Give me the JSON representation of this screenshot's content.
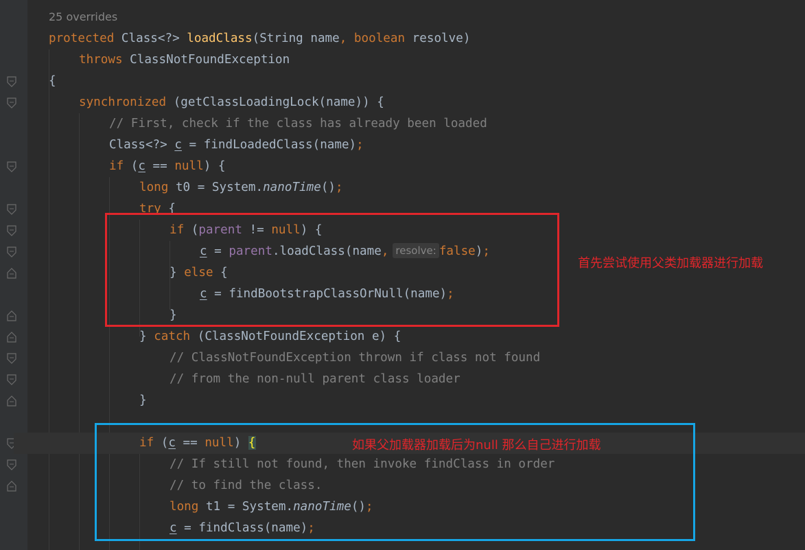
{
  "editor": {
    "override_hint": "25 overrides",
    "colors": {
      "background": "#2b2b2b",
      "keyword": "#cc7832",
      "method": "#ffc66d",
      "comment": "#808080",
      "field": "#9876aa",
      "text": "#a9b7c6",
      "annotation_red": "#e0262b",
      "annotation_blue": "#16a5e4"
    },
    "lines": {
      "l1": {
        "kw1": "protected",
        "t1": " Class<?> ",
        "fn": "loadClass",
        "t2": "(String name",
        "kw2": ",",
        "kw3": " boolean",
        "t3": " resolve)"
      },
      "l2": {
        "kw": "throws",
        "t": " ClassNotFoundException"
      },
      "l3": {
        "t": "{"
      },
      "l4": {
        "kw": "synchronized",
        "t": " (getClassLoadingLock(name)) {"
      },
      "l5": {
        "cm": "// First, check if the class has already been loaded"
      },
      "l6": {
        "t1": "Class<?> ",
        "var": "c",
        "t2": " = findLoadedClass(name)",
        "semi": ";"
      },
      "l7": {
        "kw": "if",
        "t1": " (",
        "var": "c",
        "t2": " == ",
        "kw2": "null",
        "t3": ") {"
      },
      "l8": {
        "kw": "long",
        "t1": " t0 = System.",
        "it": "nanoTime",
        "t2": "()",
        "semi": ";"
      },
      "l9": {
        "kw": "try",
        "t": " {"
      },
      "l10": {
        "kw": "if",
        "t1": " (",
        "fld": "parent",
        "t2": " != ",
        "kw2": "null",
        "t3": ") {"
      },
      "l11": {
        "var": "c",
        "t1": " = ",
        "fld": "parent",
        "t2": ".loadClass(name",
        "comma": ",",
        "hint": "resolve:",
        "kw": "false",
        "t3": ")",
        "semi": ";"
      },
      "l12": {
        "t1": "} ",
        "kw": "else",
        "t2": " {"
      },
      "l13": {
        "var": "c",
        "t1": " = findBootstrapClassOrNull(name)",
        "semi": ";"
      },
      "l14": {
        "t": "}"
      },
      "l15": {
        "t1": "} ",
        "kw": "catch",
        "t2": " (ClassNotFoundException e) {"
      },
      "l16": {
        "cm": "// ClassNotFoundException thrown if class not found"
      },
      "l17": {
        "cm": "// from the non-null parent class loader"
      },
      "l18": {
        "t": "}"
      },
      "l19": {
        "kw": "if",
        "t1": " (",
        "var": "c",
        "t2": " == ",
        "kw2": "null",
        "t3": ") ",
        "brace": "{"
      },
      "l20": {
        "cm": "// If still not found, then invoke findClass in order"
      },
      "l21": {
        "cm": "// to find the class."
      },
      "l22": {
        "kw": "long",
        "t1": " t1 = System.",
        "it": "nanoTime",
        "t2": "()",
        "semi": ";"
      },
      "l23": {
        "var": "c",
        "t1": " = findClass(name)",
        "semi": ";"
      }
    }
  },
  "annotations": {
    "red_note": "首先尝试使用父类加载器进行加载",
    "blue_note": "如果父加载器加载后为null 那么自己进行加载"
  }
}
